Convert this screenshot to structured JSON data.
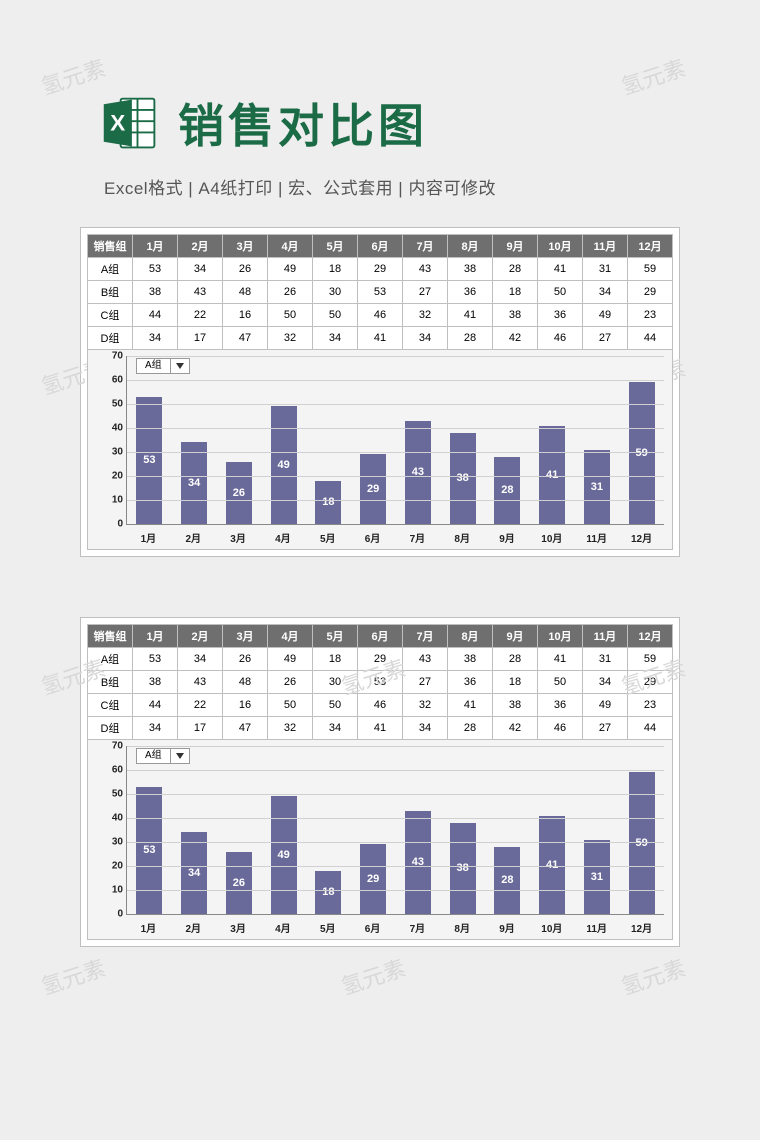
{
  "header": {
    "title": "销售对比图",
    "subtitle": "Excel格式 |  A4纸打印 | 宏、公式套用 | 内容可修改"
  },
  "watermark_text": "氢元素",
  "table": {
    "corner": "销售组",
    "months": [
      "1月",
      "2月",
      "3月",
      "4月",
      "5月",
      "6月",
      "7月",
      "8月",
      "9月",
      "10月",
      "11月",
      "12月"
    ],
    "rows": [
      {
        "label": "A组",
        "values": [
          53,
          34,
          26,
          49,
          18,
          29,
          43,
          38,
          28,
          41,
          31,
          59
        ]
      },
      {
        "label": "B组",
        "values": [
          38,
          43,
          48,
          26,
          30,
          53,
          27,
          36,
          18,
          50,
          34,
          29
        ]
      },
      {
        "label": "C组",
        "values": [
          44,
          22,
          16,
          50,
          50,
          46,
          32,
          41,
          38,
          36,
          49,
          23
        ]
      },
      {
        "label": "D组",
        "values": [
          34,
          17,
          47,
          32,
          34,
          41,
          34,
          28,
          42,
          46,
          27,
          44
        ]
      }
    ]
  },
  "chart_data": {
    "type": "bar",
    "title": "",
    "selected_series": "A组",
    "categories": [
      "1月",
      "2月",
      "3月",
      "4月",
      "5月",
      "6月",
      "7月",
      "8月",
      "9月",
      "10月",
      "11月",
      "12月"
    ],
    "series": [
      {
        "name": "A组",
        "values": [
          53,
          34,
          26,
          49,
          18,
          29,
          43,
          38,
          28,
          41,
          31,
          59
        ]
      },
      {
        "name": "B组",
        "values": [
          38,
          43,
          48,
          26,
          30,
          53,
          27,
          36,
          18,
          50,
          34,
          29
        ]
      },
      {
        "name": "C组",
        "values": [
          44,
          22,
          16,
          50,
          50,
          46,
          32,
          41,
          38,
          36,
          49,
          23
        ]
      },
      {
        "name": "D组",
        "values": [
          34,
          17,
          47,
          32,
          34,
          41,
          34,
          28,
          42,
          46,
          27,
          44
        ]
      }
    ],
    "xlabel": "",
    "ylabel": "",
    "ylim": [
      0,
      70
    ],
    "yticks": [
      0,
      10,
      20,
      30,
      40,
      50,
      60,
      70
    ],
    "bar_color": "#6a6a9a"
  }
}
